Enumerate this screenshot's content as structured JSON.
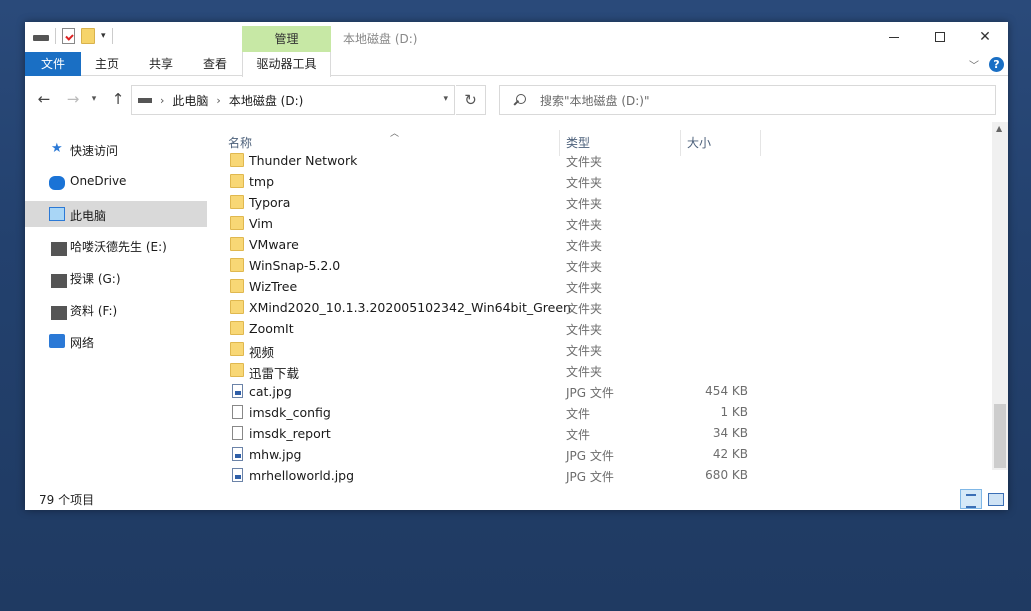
{
  "window": {
    "title": "本地磁盘 (D:)",
    "context_tab": "管理"
  },
  "ribbon": {
    "tabs": [
      "文件",
      "主页",
      "共享",
      "查看",
      "驱动器工具"
    ]
  },
  "address": {
    "crumbs": [
      "此电脑",
      "本地磁盘 (D:)"
    ]
  },
  "search": {
    "placeholder": "搜索\"本地磁盘 (D:)\""
  },
  "nav_pane": {
    "items": [
      {
        "label": "快速访问",
        "icon": "star-icon"
      },
      {
        "label": "OneDrive",
        "icon": "cloud-icon"
      },
      {
        "label": "此电脑",
        "icon": "computer-icon",
        "selected": true
      },
      {
        "label": "哈喽沃德先生 (E:)",
        "icon": "drive-icon"
      },
      {
        "label": "授课 (G:)",
        "icon": "drive-icon"
      },
      {
        "label": "资料 (F:)",
        "icon": "drive-icon"
      },
      {
        "label": "网络",
        "icon": "network-icon"
      }
    ]
  },
  "file_list": {
    "columns": {
      "name": "名称",
      "type": "类型",
      "size": "大小"
    },
    "rows": [
      {
        "name": "Thunder Network",
        "type": "文件夹",
        "size": "",
        "kind": "folder"
      },
      {
        "name": "tmp",
        "type": "文件夹",
        "size": "",
        "kind": "folder"
      },
      {
        "name": "Typora",
        "type": "文件夹",
        "size": "",
        "kind": "folder"
      },
      {
        "name": "Vim",
        "type": "文件夹",
        "size": "",
        "kind": "folder"
      },
      {
        "name": "VMware",
        "type": "文件夹",
        "size": "",
        "kind": "folder"
      },
      {
        "name": "WinSnap-5.2.0",
        "type": "文件夹",
        "size": "",
        "kind": "folder"
      },
      {
        "name": "WizTree",
        "type": "文件夹",
        "size": "",
        "kind": "folder"
      },
      {
        "name": "XMind2020_10.1.3.202005102342_Win64bit_Green",
        "type": "文件夹",
        "size": "",
        "kind": "folder"
      },
      {
        "name": "ZoomIt",
        "type": "文件夹",
        "size": "",
        "kind": "folder"
      },
      {
        "name": "视频",
        "type": "文件夹",
        "size": "",
        "kind": "folder"
      },
      {
        "name": "迅雷下载",
        "type": "文件夹",
        "size": "",
        "kind": "folder"
      },
      {
        "name": "cat.jpg",
        "type": "JPG 文件",
        "size": "454 KB",
        "kind": "jpg"
      },
      {
        "name": "imsdk_config",
        "type": "文件",
        "size": "1 KB",
        "kind": "file"
      },
      {
        "name": "imsdk_report",
        "type": "文件",
        "size": "34 KB",
        "kind": "file"
      },
      {
        "name": "mhw.jpg",
        "type": "JPG 文件",
        "size": "42 KB",
        "kind": "jpg"
      },
      {
        "name": "mrhelloworld.jpg",
        "type": "JPG 文件",
        "size": "680 KB",
        "kind": "jpg"
      }
    ]
  },
  "status": {
    "count": "79 个项目"
  },
  "colors": {
    "file_tab": "#1a6fc4",
    "context_tab": "#c7e8a5",
    "selected_nav": "#d9d9d9"
  }
}
